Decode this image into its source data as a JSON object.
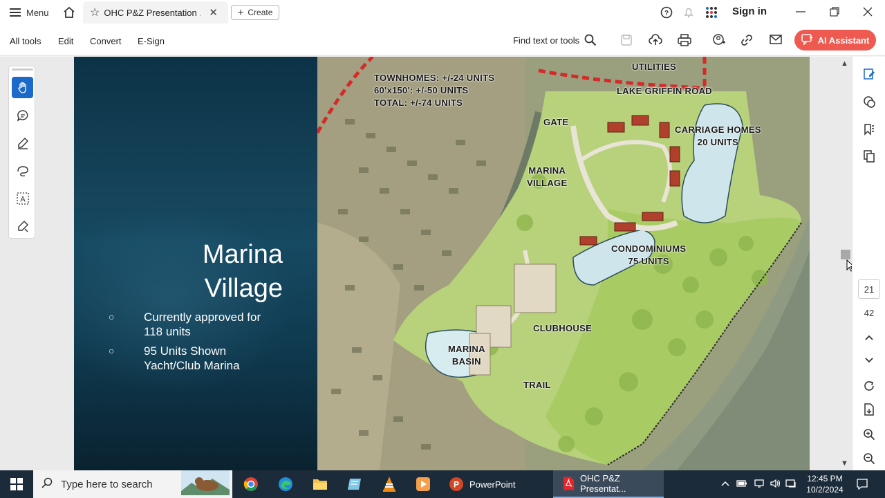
{
  "window": {
    "menu_label": "Menu",
    "tab_title": "OHC P&Z Presentation ...",
    "create_label": "Create",
    "sign_in_label": "Sign in"
  },
  "toolbar": {
    "items": [
      "All tools",
      "Edit",
      "Convert",
      "E-Sign"
    ],
    "find_label": "Find text or tools",
    "ai_label": "AI Assistant"
  },
  "slide": {
    "title_line1": "Marina",
    "title_line2": "Village",
    "bullet_symbol": "○",
    "bullets": [
      {
        "line1": "Currently approved for",
        "line2": "118 units"
      },
      {
        "line1": "95 Units Shown",
        "line2": "Yacht/Club Marina"
      }
    ]
  },
  "map": {
    "labels": {
      "utilities": "UTILITIES",
      "townhomes_1": "TOWNHOMES: +/-24 UNITS",
      "townhomes_2": "60'x150': +/-50 UNITS",
      "townhomes_3": "TOTAL: +/-74 UNITS",
      "lake_griffin": "LAKE GRIFFIN ROAD",
      "gate": "GATE",
      "carriage_1": "CARRIAGE HOMES",
      "carriage_2": "20 UNITS",
      "marina_village_1": "MARINA",
      "marina_village_2": "VILLAGE",
      "condo_1": "CONDOMINIUMS",
      "condo_2": "75 UNITS",
      "clubhouse": "CLUBHOUSE",
      "marina_basin_1": "MARINA",
      "marina_basin_2": "BASIN",
      "trail": "TRAIL"
    }
  },
  "right_panel": {
    "page_current": "21",
    "page_total": "42"
  },
  "taskbar": {
    "search_placeholder": "Type here to search",
    "apps": [
      "PowerPoint",
      "OHC P&Z Presentat..."
    ],
    "time": "12:45 PM",
    "date": "10/2/2024"
  },
  "colors": {
    "accent_blue": "#1b6ac9",
    "ai_button": "#ef5a50",
    "taskbar": "#1c2b3a"
  }
}
